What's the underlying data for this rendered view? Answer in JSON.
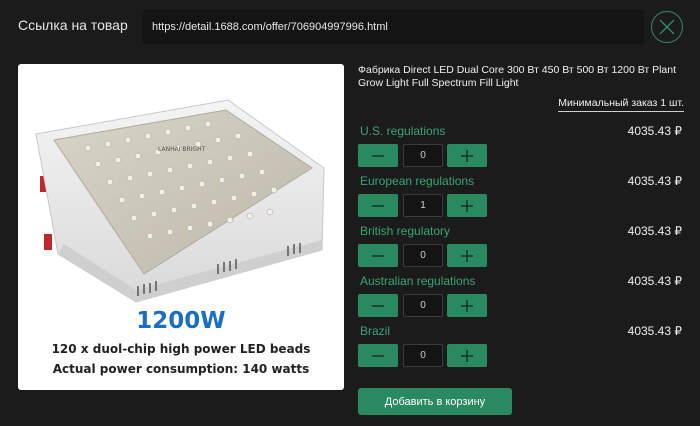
{
  "header": {
    "link_label": "Ссылка на товар",
    "url_value": "https://detail.1688.com/offer/706904997996.html",
    "close_icon": "close-x-circle-icon"
  },
  "product": {
    "title": "Фабрика Direct LED Dual Core 300 Вт 450 Вт 500 Вт 1200 Вт Plant Grow Light Full Spectrum Fill Light",
    "min_order": "Минимальный заказ 1 шт.",
    "image": {
      "brand": "LANHAI BRIGHT",
      "power_text": "1200W",
      "caption_line1": "120 x duol-chip high power LED beads",
      "caption_line2": "Actual power consumption: 140 watts"
    }
  },
  "variants": [
    {
      "name": "U.S. regulations",
      "price": "4035.43 ₽",
      "qty": "0"
    },
    {
      "name": "European regulations",
      "price": "4035.43 ₽",
      "qty": "1"
    },
    {
      "name": "British regulatory",
      "price": "4035.43 ₽",
      "qty": "0"
    },
    {
      "name": "Australian regulations",
      "price": "4035.43 ₽",
      "qty": "0"
    },
    {
      "name": "Brazil",
      "price": "4035.43 ₽",
      "qty": "0"
    }
  ],
  "cart": {
    "add_label": "Добавить в корзину"
  },
  "colors": {
    "accent": "#2a8a5f",
    "accent_text": "#3aa574",
    "background": "#1b1b1b"
  }
}
